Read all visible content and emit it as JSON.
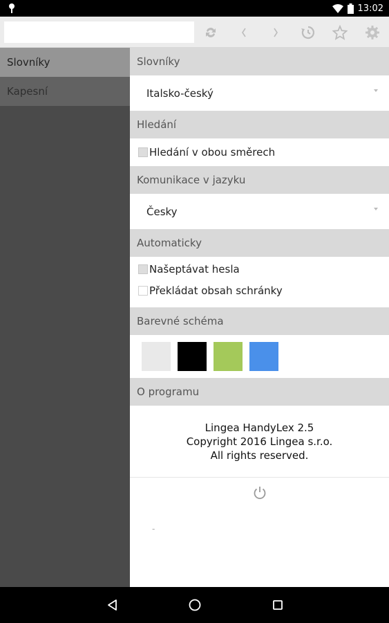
{
  "status_bar": {
    "time": "13:02",
    "icons": [
      "notification-icon",
      "wifi-icon",
      "battery-icon"
    ]
  },
  "toolbar": {
    "search_value": "",
    "buttons": [
      "sync-icon",
      "back-icon",
      "forward-icon",
      "history-icon",
      "star-icon",
      "gear-icon"
    ]
  },
  "sidebar": {
    "items": [
      {
        "label": "Slovníky"
      },
      {
        "label": "Kapesní"
      }
    ]
  },
  "settings": {
    "dictionaries_header": "Slovníky",
    "dictionary_value": "Italsko-český",
    "search_header": "Hledání",
    "bidirectional_label": "Hledání v obou směrech",
    "bidirectional_checked": true,
    "language_header": "Komunikace v jazyku",
    "language_value": "Česky",
    "auto_header": "Automaticky",
    "suggest_label": "Našeptávat hesla",
    "suggest_checked": true,
    "clipboard_label": "Překládat obsah schránky",
    "clipboard_checked": false,
    "color_header": "Barevné schéma",
    "color_swatches": [
      "#e9e9e9",
      "#000000",
      "#a4c95a",
      "#4a90ea"
    ],
    "about_header": "O programu",
    "about_lines": [
      "Lingea HandyLex 2.5",
      "Copyright 2016 Lingea s.r.o.",
      "All rights reserved."
    ],
    "footer_mark": "-"
  },
  "nav_bar": {
    "buttons": [
      "back-nav-icon",
      "home-nav-icon",
      "recents-nav-icon"
    ]
  },
  "colors": {
    "sidebar_bg": "#4a4a4a",
    "sidebar_active": "#959595",
    "section_header_bg": "#d9d9d9",
    "toolbar_bg": "#ececec"
  }
}
